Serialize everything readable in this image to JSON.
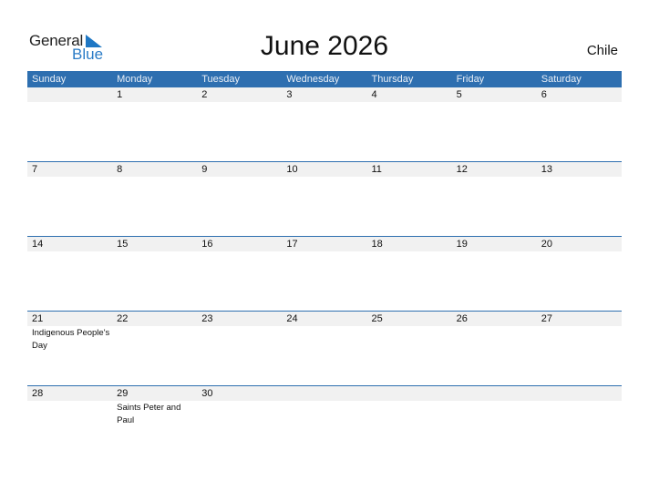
{
  "logo": {
    "general": "General",
    "blue": "Blue"
  },
  "title": "June 2026",
  "country": "Chile",
  "colors": {
    "accent": "#2e6fb0",
    "strip": "#f1f1f1"
  },
  "weekdays": [
    "Sunday",
    "Monday",
    "Tuesday",
    "Wednesday",
    "Thursday",
    "Friday",
    "Saturday"
  ],
  "weeks": [
    {
      "days": [
        "",
        "1",
        "2",
        "3",
        "4",
        "5",
        "6"
      ],
      "events": [
        "",
        "",
        "",
        "",
        "",
        "",
        ""
      ]
    },
    {
      "days": [
        "7",
        "8",
        "9",
        "10",
        "11",
        "12",
        "13"
      ],
      "events": [
        "",
        "",
        "",
        "",
        "",
        "",
        ""
      ]
    },
    {
      "days": [
        "14",
        "15",
        "16",
        "17",
        "18",
        "19",
        "20"
      ],
      "events": [
        "",
        "",
        "",
        "",
        "",
        "",
        ""
      ]
    },
    {
      "days": [
        "21",
        "22",
        "23",
        "24",
        "25",
        "26",
        "27"
      ],
      "events": [
        "Indigenous People's Day",
        "",
        "",
        "",
        "",
        "",
        ""
      ]
    },
    {
      "days": [
        "28",
        "29",
        "30",
        "",
        "",
        "",
        ""
      ],
      "events": [
        "",
        "Saints Peter and Paul",
        "",
        "",
        "",
        "",
        ""
      ]
    }
  ]
}
